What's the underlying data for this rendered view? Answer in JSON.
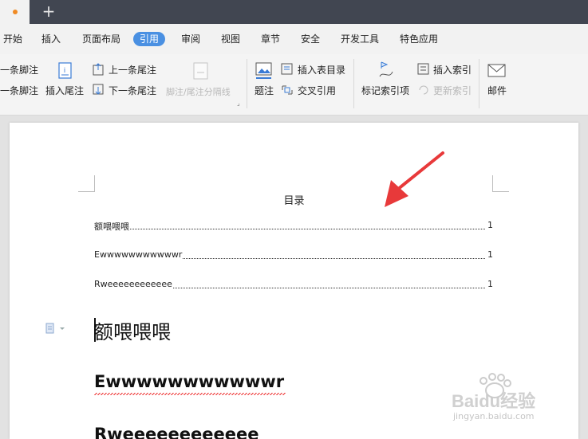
{
  "menubar": {
    "tabs": [
      "开始",
      "插入",
      "页面布局",
      "引用",
      "审阅",
      "视图",
      "章节",
      "安全",
      "开发工具",
      "特色应用"
    ],
    "active_tab": "引用"
  },
  "ribbon": {
    "prev_footnote": "一条脚注",
    "next_footnote": "一条脚注",
    "insert_endnote": "插入尾注",
    "prev_endnote": "上一条尾注",
    "next_endnote": "下一条尾注",
    "separator_line": "脚注/尾注分隔线",
    "caption": "题注",
    "insert_table_of_figures": "插入表目录",
    "cross_reference": "交叉引用",
    "mark_index_entry": "标记索引项",
    "insert_index": "插入索引",
    "update_index": "更新索引",
    "mail": "邮件"
  },
  "document": {
    "toc_title": "目录",
    "toc_entries": [
      {
        "text": "额喂喂喂",
        "page": "1"
      },
      {
        "text": "Ewwwwwwwwwwwr",
        "page": "1"
      },
      {
        "text": "Rweeeeeeeeeeee",
        "page": "1"
      }
    ],
    "headings": [
      "额喂喂喂",
      "Ewwwwwwwwwwwr",
      "Rweeeeeeeeeeee"
    ]
  },
  "watermark": {
    "brand": "Baidu经验",
    "url": "jingyan.baidu.com"
  },
  "colors": {
    "accent": "#4a90e2",
    "arrow": "#e8393a",
    "titlebar": "#414651"
  }
}
